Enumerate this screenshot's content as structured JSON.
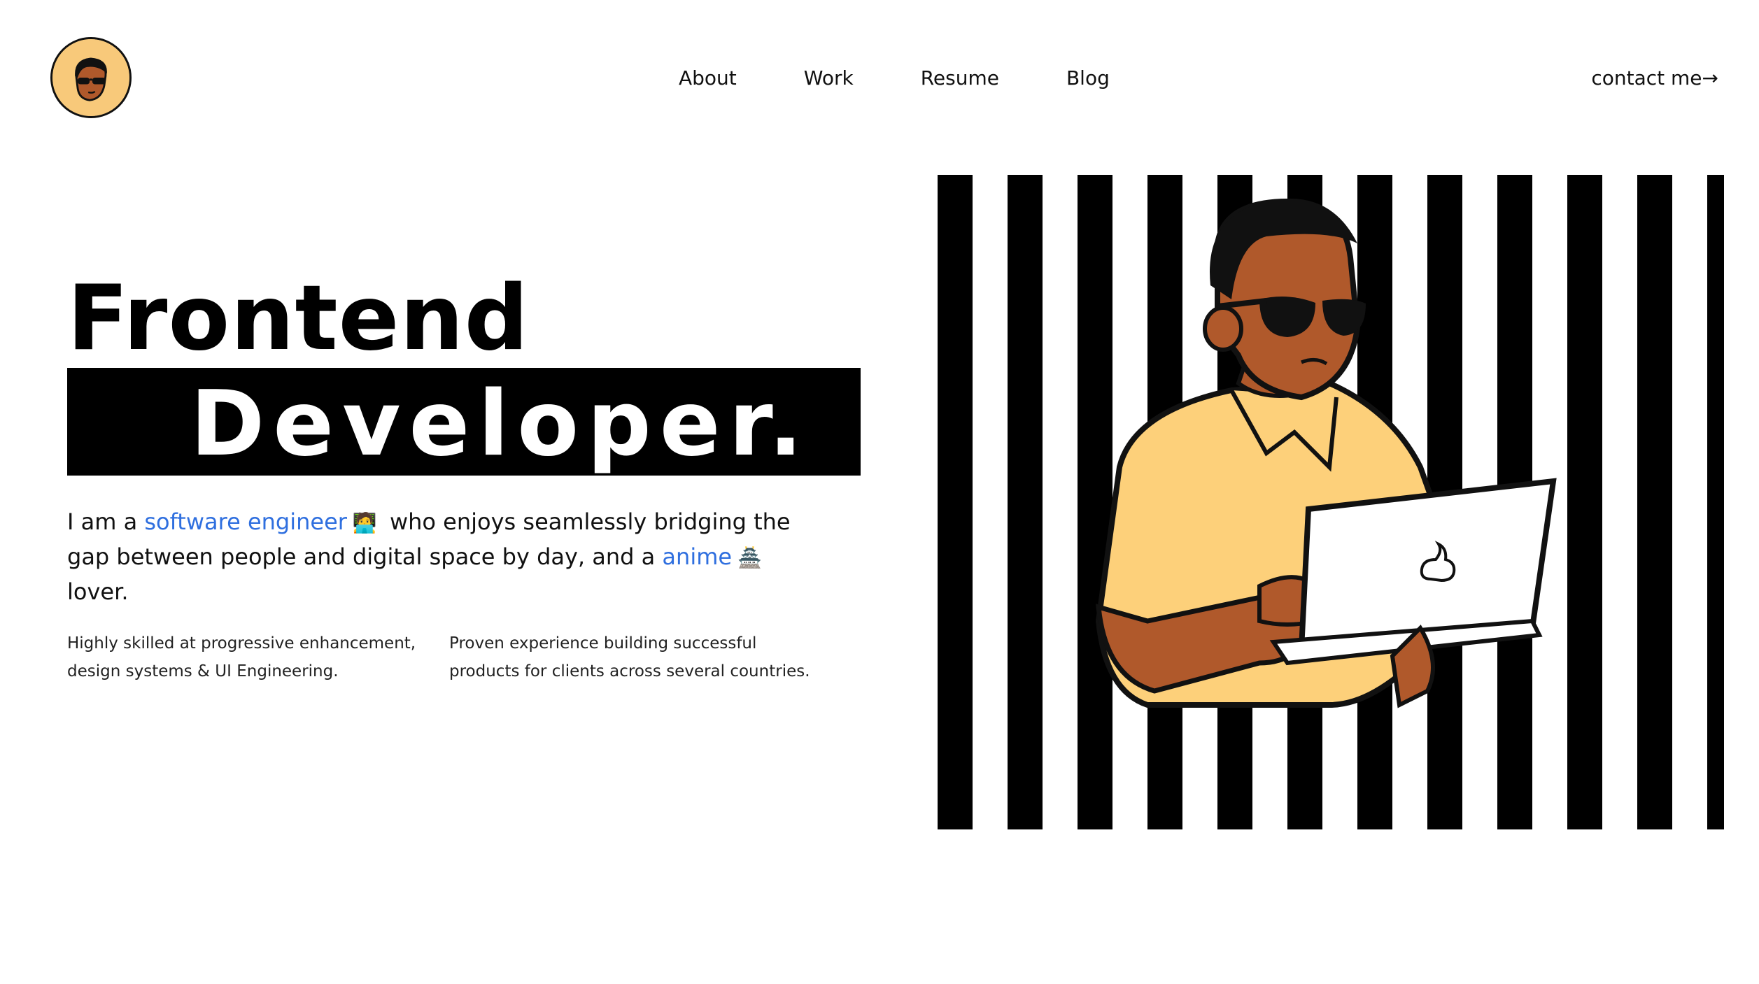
{
  "header": {
    "nav": [
      {
        "label": "About"
      },
      {
        "label": "Work"
      },
      {
        "label": "Resume"
      },
      {
        "label": "Blog"
      }
    ],
    "contact_label": "contact me→"
  },
  "hero": {
    "title_line1": "Frontend",
    "title_line2": "Developer.",
    "intro": {
      "part1": "I am a ",
      "link1": "software engineer",
      "emoji1": "🧑‍💻",
      "part2": " who enjoys seamlessly bridging the gap between people and digital space by day, and a ",
      "link2": "anime",
      "emoji2": "🏯",
      "part3": " lover."
    },
    "features": [
      {
        "text": "Highly skilled at progressive enhancement, design systems & UI Engineering."
      },
      {
        "text": "Proven experience building successful products for clients across several countries."
      }
    ]
  },
  "colors": {
    "accent": "#2f6fdf",
    "avatar_bg": "#f8c97a",
    "shirt": "#fdd07a",
    "skin": "#b0592b"
  },
  "icons": {
    "logo": "avatar-face-icon",
    "laptop_logo": "swirl-icon"
  }
}
